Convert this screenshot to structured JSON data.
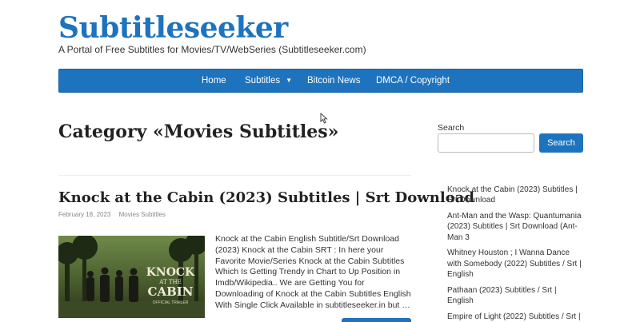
{
  "site": {
    "title": "Subtitleseeker",
    "description": "A Portal of Free Subtitles for Movies/TV/WebSeries (Subtitleseeker.com)"
  },
  "nav": {
    "items": [
      {
        "label": "Home"
      },
      {
        "label": "Subtitles",
        "icon": "chevron-down-icon"
      },
      {
        "label": "Bitcoin News"
      },
      {
        "label": "DMCA / Copyright"
      }
    ]
  },
  "page": {
    "heading": "Category «Movies Subtitles»"
  },
  "post": {
    "title": "Knock at the Cabin (2023) Subtitles | Srt Download",
    "date": "February 18, 2023",
    "category": "Movies Subtitles",
    "thumbnail_title_line1": "KNOCK",
    "thumbnail_title_line2": "AT THE",
    "thumbnail_title_line3": "CABIN",
    "thumbnail_caption": "OFFICIAL TRAILER",
    "excerpt": "Knock at the Cabin English Subtitle/Srt Download (2023) Knock at the Cabin SRT : In here your Favorite Movie/Series Knock at the Cabin Subtitles Which Is Getting Trendy in Chart to Up Position in Imdb/Wikipedia.. We are Getting You for Downloading of Knock at the Cabin Subtitles English With Single Click Available in subtitleseeker.in but …"
  },
  "sidebar": {
    "search_label": "Search",
    "search_placeholder": "",
    "search_button": "Search",
    "recent_posts": [
      "Knock at the Cabin (2023) Subtitles | Srt Download",
      "Ant-Man and the Wasp: Quantumania (2023) Subtitles | Srt Download (Ant-Man 3",
      "Whitney Houston ; I Wanna Dance with Somebody (2022) Subtitles / Srt | English",
      "Pathaan (2023) Subtitles / Srt | English",
      "Empire of Light (2022) Subtitles / Srt |"
    ]
  },
  "colors": {
    "brand": "#1e73be",
    "heading": "#222222",
    "text": "#333333",
    "meta": "#888888"
  }
}
